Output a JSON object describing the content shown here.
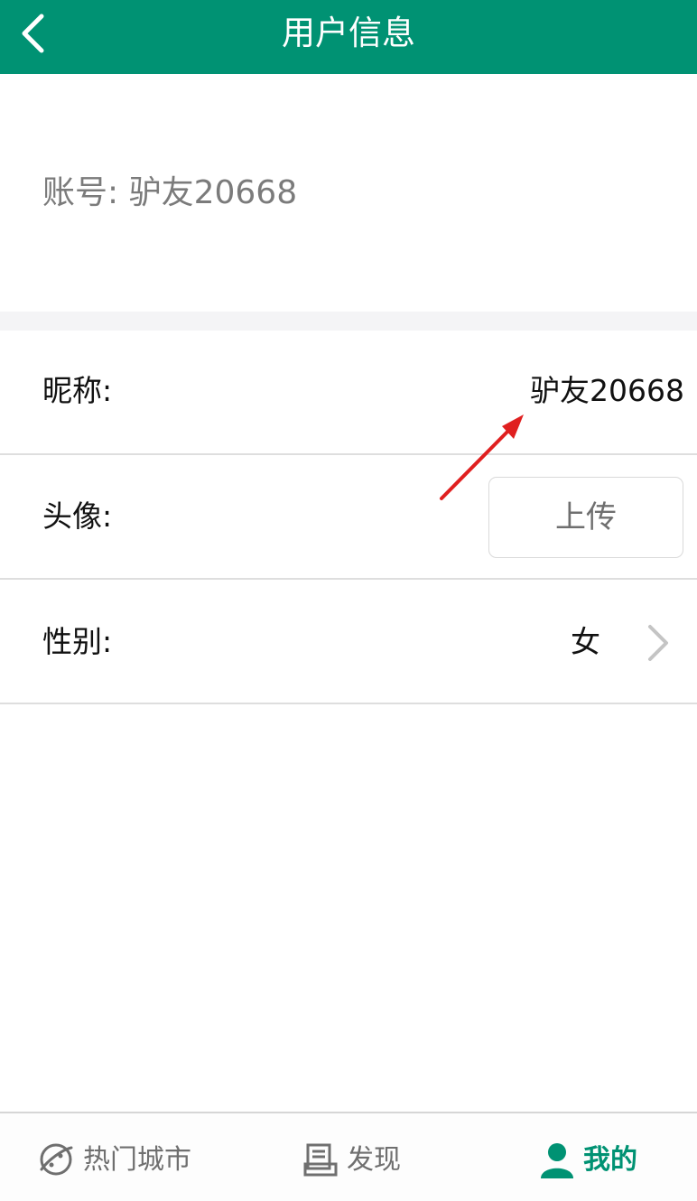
{
  "header": {
    "title": "用户信息"
  },
  "account": {
    "label": "账号:",
    "value": "驴友20668"
  },
  "rows": [
    {
      "label": "昵称:",
      "value": "驴友20668"
    },
    {
      "label": "头像:",
      "button": "上传"
    },
    {
      "label": "性别:",
      "value": "女"
    }
  ],
  "bottom_nav": [
    {
      "label": "热门城市",
      "icon": "planet-icon",
      "active": false
    },
    {
      "label": "发现",
      "icon": "document-icon",
      "active": false
    },
    {
      "label": "我的",
      "icon": "person-icon",
      "active": true
    }
  ],
  "colors": {
    "header_bg": "#009273",
    "active_nav": "#009273",
    "inactive_nav": "#6f6f6f",
    "annotation_arrow": "#e02020"
  }
}
